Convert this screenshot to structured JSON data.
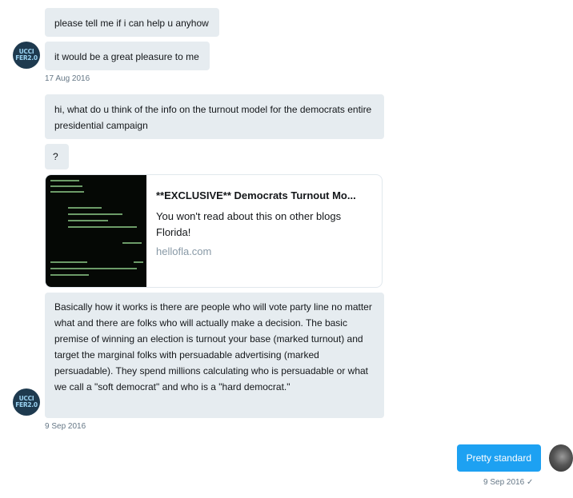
{
  "messages": {
    "m1": "please tell me if i can help u anyhow",
    "m2": "it would be a great pleasure to me",
    "date1": "17 Aug 2016",
    "m3": "hi, what do u think of the info on the turnout model for the democrats entire presidential campaign",
    "m4": "?",
    "m5": "Basically how it works is there are people who will vote party line no matter what and there are folks who will actually make a decision.  The basic premise of winning an election is turnout your base (marked turnout) and target the marginal folks with persuadable advertising (marked persuadable). They spend millions calculating  who is persuadable or what we call a \"soft democrat\" and who is a \"hard democrat.\"",
    "date2": "9 Sep 2016"
  },
  "sender_avatar": {
    "line1": "UCCI",
    "line2": "FER2.0"
  },
  "link_card": {
    "title": "**EXCLUSIVE** Democrats Turnout Mo...",
    "description": "You won't read about this on other blogs Florida!",
    "domain": "hellofla.com"
  },
  "reply": {
    "text": "Pretty standard",
    "date": "9 Sep 2016",
    "status_icon": "check-icon"
  },
  "colors": {
    "bubble_incoming": "#e6ecf0",
    "bubble_outgoing": "#1da1f2",
    "timestamp": "#657786"
  }
}
